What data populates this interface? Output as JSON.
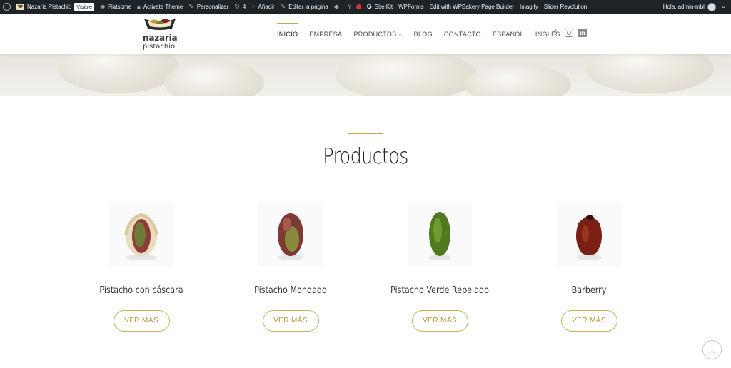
{
  "adminbar": {
    "site_name": "Nazaria Pistachio",
    "visible_badge": "Visible",
    "flatsome": "Flatsome",
    "activate_theme": "Activate Theme",
    "personalizar": "Personalizar",
    "updates_count": "4",
    "anadir": "Añadir",
    "editar_pagina": "Editar la página",
    "site_kit": "Site Kit",
    "wpforms": "WPForms",
    "wpbakery": "Edit with WPBakery Page Builder",
    "imagify": "Imagify",
    "slider_revolution": "Slider Revolution",
    "greeting": "Hola, admin-mbl"
  },
  "logo": {
    "name": "nazaria",
    "sub": "pistachio"
  },
  "nav": {
    "items": [
      {
        "label": "INICIO"
      },
      {
        "label": "EMPRESA"
      },
      {
        "label": "PRODUCTOS"
      },
      {
        "label": "BLOG"
      },
      {
        "label": "CONTACTO"
      },
      {
        "label": "ESPAÑOL"
      },
      {
        "label": "INGLÉS"
      }
    ]
  },
  "section": {
    "title": "Productos"
  },
  "products": [
    {
      "name": "Pistacho con cáscara",
      "button": "VER MÁS"
    },
    {
      "name": "Pistacho Mondado",
      "button": "VER MÁS"
    },
    {
      "name": "Pistacho Verde Repelado",
      "button": "VER MÁS"
    },
    {
      "name": "Barberry",
      "button": "VER MÁS"
    }
  ],
  "colors": {
    "accent": "#c9a642",
    "adminbar": "#1d2327",
    "button_text": "#b8993a"
  }
}
